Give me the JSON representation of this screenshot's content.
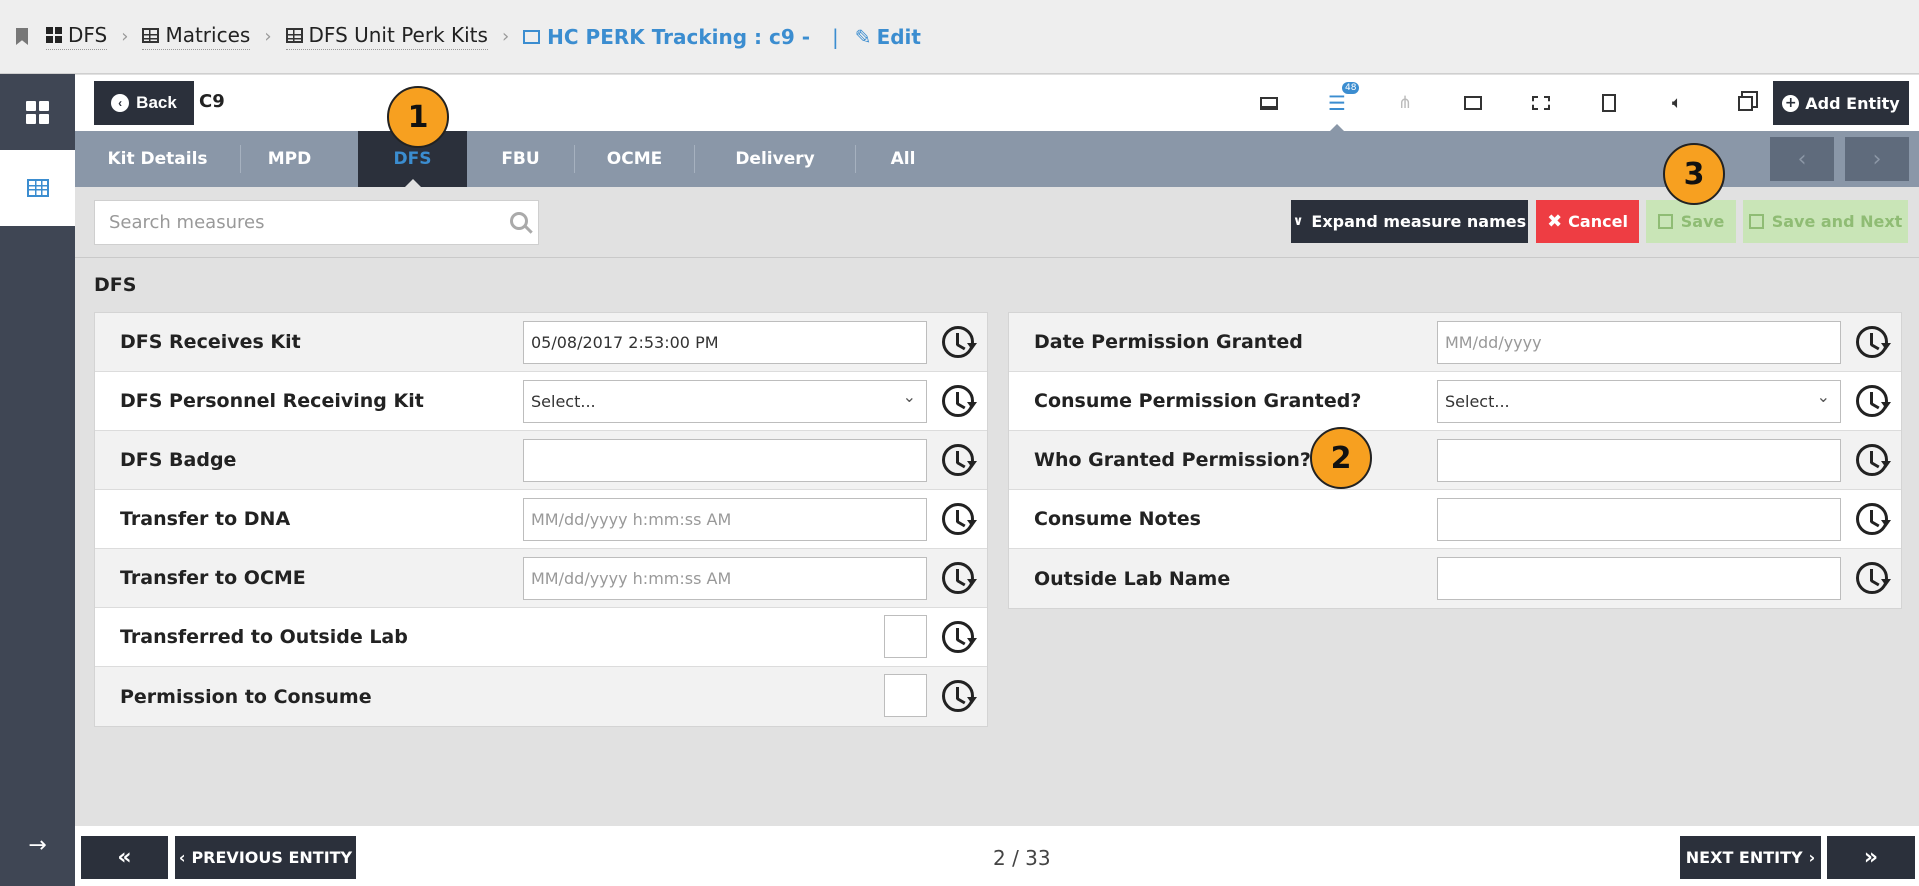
{
  "breadcrumb": {
    "items": [
      "DFS",
      "Matrices",
      "DFS Unit Perk Kits"
    ],
    "active": "HC PERK Tracking : c9  -",
    "edit": "Edit"
  },
  "entity": {
    "back_label": "Back",
    "title": "C9",
    "badge_count": "48",
    "add_entity_label": "Add Entity",
    "tool_icons": [
      "desktop-icon",
      "list-icon",
      "sitemap-icon",
      "image-icon",
      "film-icon",
      "file-icon",
      "volume-icon",
      "clone-icon"
    ]
  },
  "tabs": [
    "Kit Details",
    "MPD",
    "DFS",
    "FBU",
    "OCME",
    "Delivery",
    "All"
  ],
  "active_tab": "DFS",
  "toolbar": {
    "search_placeholder": "Search measures",
    "expand_label": "Expand measure names",
    "cancel_label": "Cancel",
    "save_label": "Save",
    "save_next_label": "Save and Next"
  },
  "section": {
    "title": "DFS"
  },
  "left_fields": [
    {
      "label": "DFS Receives Kit",
      "type": "text",
      "value": "05/08/2017 2:53:00 PM"
    },
    {
      "label": "DFS Personnel Receiving Kit",
      "type": "select",
      "value": "Select..."
    },
    {
      "label": "DFS Badge",
      "type": "text",
      "value": ""
    },
    {
      "label": "Transfer to DNA",
      "type": "placeholder",
      "value": "MM/dd/yyyy h:mm:ss AM"
    },
    {
      "label": "Transfer to OCME",
      "type": "placeholder",
      "value": "MM/dd/yyyy h:mm:ss AM"
    },
    {
      "label": "Transferred to Outside Lab",
      "type": "checkbox",
      "value": ""
    },
    {
      "label": "Permission to Consume",
      "type": "checkbox",
      "value": ""
    }
  ],
  "right_fields": [
    {
      "label": "Date Permission Granted",
      "type": "placeholder",
      "value": "MM/dd/yyyy"
    },
    {
      "label": "Consume Permission Granted?",
      "type": "select",
      "value": "Select..."
    },
    {
      "label": "Who Granted Permission?",
      "type": "text",
      "value": ""
    },
    {
      "label": "Consume Notes",
      "type": "text",
      "value": ""
    },
    {
      "label": "Outside Lab Name",
      "type": "text",
      "value": ""
    }
  ],
  "annotations": [
    "1",
    "2",
    "3"
  ],
  "footer": {
    "previous_label": "PREVIOUS ENTITY",
    "next_label": "NEXT ENTITY",
    "page_count": "2 / 33",
    "first_glyph": "«",
    "last_glyph": "»"
  }
}
